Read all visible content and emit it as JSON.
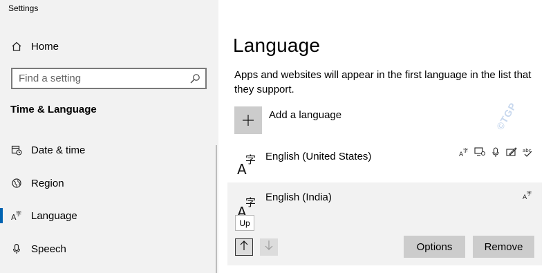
{
  "window": {
    "title": "Settings"
  },
  "sidebar": {
    "home": {
      "label": "Home",
      "icon": "home-icon"
    },
    "search": {
      "placeholder": "Find a setting",
      "icon": "search-icon"
    },
    "section_title": "Time & Language",
    "items": [
      {
        "label": "Date & time",
        "icon": "calendar-clock-icon",
        "active": false
      },
      {
        "label": "Region",
        "icon": "globe-icon",
        "active": false
      },
      {
        "label": "Language",
        "icon": "language-icon",
        "active": true
      },
      {
        "label": "Speech",
        "icon": "microphone-icon",
        "active": false
      }
    ],
    "accent_color": "#0063b1"
  },
  "main": {
    "title": "Language",
    "description": "Apps and websites will appear in the first language in the list that they support.",
    "add_language": {
      "label": "Add a language",
      "icon": "plus-icon"
    },
    "languages": [
      {
        "name": "English (United States)",
        "icon": "language-icon",
        "features": [
          "display-language-icon",
          "text-to-speech-icon",
          "speech-recognition-icon",
          "handwriting-icon",
          "spellcheck-icon"
        ]
      },
      {
        "name": "English (India)",
        "icon": "language-icon",
        "features": [
          "display-language-icon"
        ],
        "selected": true,
        "tooltip": "Up",
        "buttons": {
          "options": "Options",
          "remove": "Remove"
        }
      }
    ],
    "watermark": "©TGP"
  }
}
